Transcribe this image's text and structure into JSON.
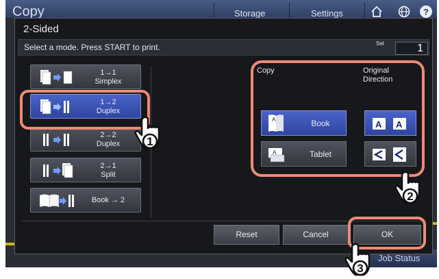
{
  "background": {
    "app_title": "Copy",
    "tabs": [
      "Storage",
      "Settings"
    ],
    "icons": [
      "home-icon",
      "globe-icon",
      "help-icon"
    ],
    "job_status_label": "Job Status"
  },
  "dialog": {
    "title": "2-Sided",
    "instruction": "Select a mode. Press START to print.",
    "set_label": "Set",
    "set_value": "1",
    "modes": [
      {
        "label": "1→1\nSimplex",
        "selected": false
      },
      {
        "label": "1→2\nDuplex",
        "selected": true
      },
      {
        "label": "2→2\nDuplex",
        "selected": false
      },
      {
        "label": "2→1\nSplit",
        "selected": false
      },
      {
        "label": "Book → 2",
        "selected": false
      }
    ],
    "copy_heading": "Copy",
    "direction_heading": "Original\nDirection",
    "copy_options": [
      {
        "label": "Book",
        "selected": true
      },
      {
        "label": "Tablet",
        "selected": false
      }
    ],
    "direction_options": [
      {
        "glyph": "A A",
        "selected": true
      },
      {
        "glyph": "< <",
        "selected": false
      }
    ],
    "buttons": {
      "reset": "Reset",
      "cancel": "Cancel",
      "ok": "OK"
    }
  },
  "callouts": [
    "1",
    "2",
    "3"
  ],
  "colors": {
    "highlight": "#ef8b74",
    "selected": "#3b55b8",
    "dialog_bg": "#17181b"
  }
}
